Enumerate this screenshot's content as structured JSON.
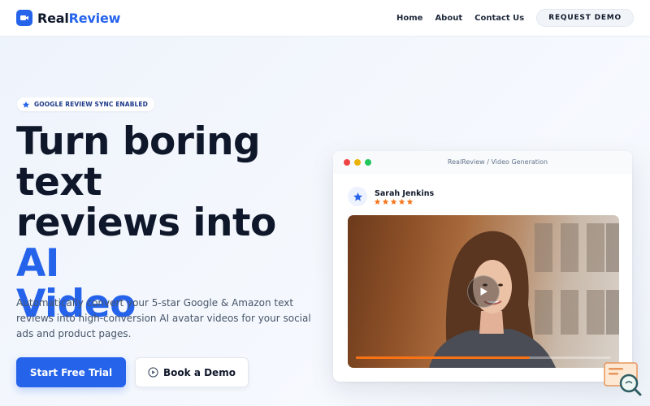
{
  "colors": {
    "accent": "#2563eb",
    "text": "#0f172a",
    "muted": "#475569",
    "progress": "#f97316",
    "stars": "#f97316"
  },
  "nav": {
    "brand_part1": "Real",
    "brand_part2": "Review",
    "brand_icon": "video-camera-icon",
    "links": [
      "Home",
      "About",
      "Contact Us"
    ],
    "cta": "REQUEST DEMO"
  },
  "hero": {
    "badge": "GOOGLE REVIEW SYNC ENABLED",
    "badge_icon": "star-icon",
    "title_line1": "Turn boring",
    "title_line2": "text",
    "title_line3": "reviews into",
    "title_accent1": "AI",
    "title_accent2": "Video",
    "description": "Automatically convert your 5-star Google & Amazon text reviews into high-conversion AI avatar videos for your social ads and product pages.",
    "primary_button": "Start Free Trial",
    "secondary_button": "Book a Demo",
    "secondary_icon": "play-circle-icon"
  },
  "preview": {
    "window_title": "RealReview / Video Generation",
    "reviewer_name": "Sarah Jenkins",
    "rating": 5,
    "progress": 0.68,
    "play_icon": "play-icon"
  },
  "helper_icon": "search-chat-icon"
}
